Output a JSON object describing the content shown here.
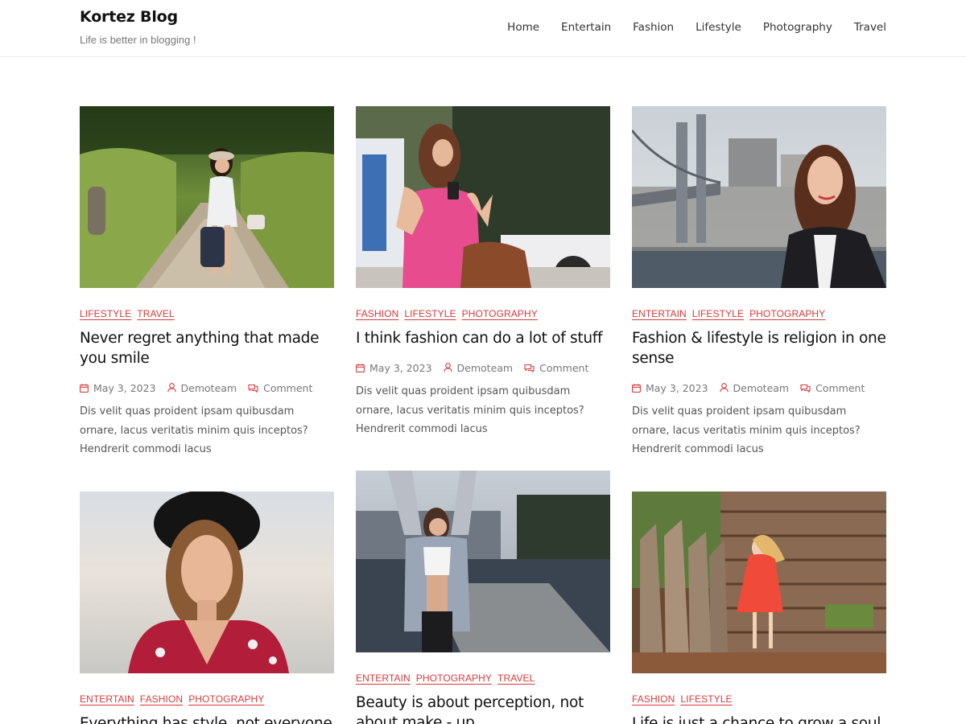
{
  "site": {
    "title": "Kortez Blog",
    "tagline": "Life is better in blogging !"
  },
  "nav": {
    "items": [
      {
        "label": "Home"
      },
      {
        "label": "Entertain"
      },
      {
        "label": "Fashion"
      },
      {
        "label": "Lifestyle"
      },
      {
        "label": "Photography"
      },
      {
        "label": "Travel"
      }
    ]
  },
  "colors": {
    "accent": "#d9383a",
    "text": "#111111",
    "muted": "#777777"
  },
  "posts": [
    {
      "image": "woman-walking-path-with-suitcase-photo",
      "categories": [
        "LIFESTYLE",
        "TRAVEL"
      ],
      "title": "Never regret anything that made you smile",
      "date": "May 3, 2023",
      "author": "Demoteam",
      "comment": "Comment",
      "excerpt": "Dis velit quas proident ipsam quibusdam ornare, lacus veritatis minim quis inceptos? Hendrerit commodi lacus"
    },
    {
      "image": "woman-pink-top-with-phone-photo",
      "categories": [
        "FASHION",
        "LIFESTYLE",
        "PHOTOGRAPHY"
      ],
      "title": "I think fashion can do a lot of stuff",
      "date": "May 3, 2023",
      "author": "Demoteam",
      "comment": "Comment",
      "excerpt": "Dis velit quas proident ipsam quibusdam ornare, lacus veritatis minim quis inceptos? Hendrerit commodi lacus"
    },
    {
      "image": "woman-leather-jacket-bridge-photo",
      "categories": [
        "ENTERTAIN",
        "LIFESTYLE",
        "PHOTOGRAPHY"
      ],
      "title": "Fashion & lifestyle is religion in one sense",
      "date": "May 3, 2023",
      "author": "Demoteam",
      "comment": "Comment",
      "excerpt": "Dis velit quas proident ipsam quibusdam ornare, lacus veritatis minim quis inceptos? Hendrerit commodi lacus"
    },
    {
      "image": "woman-black-hat-portrait-photo",
      "categories": [
        "ENTERTAIN",
        "FASHION",
        "PHOTOGRAPHY"
      ],
      "title": "Everything has style, not everyone sees it"
    },
    {
      "image": "woman-stretching-dock-photo",
      "categories": [
        "ENTERTAIN",
        "PHOTOGRAPHY",
        "TRAVEL"
      ],
      "title": "Beauty is about perception, not about make - up"
    },
    {
      "image": "girl-red-dress-wooden-fence-photo",
      "categories": [
        "FASHION",
        "LIFESTYLE"
      ],
      "title": "Life is just a chance to grow a soul"
    }
  ]
}
